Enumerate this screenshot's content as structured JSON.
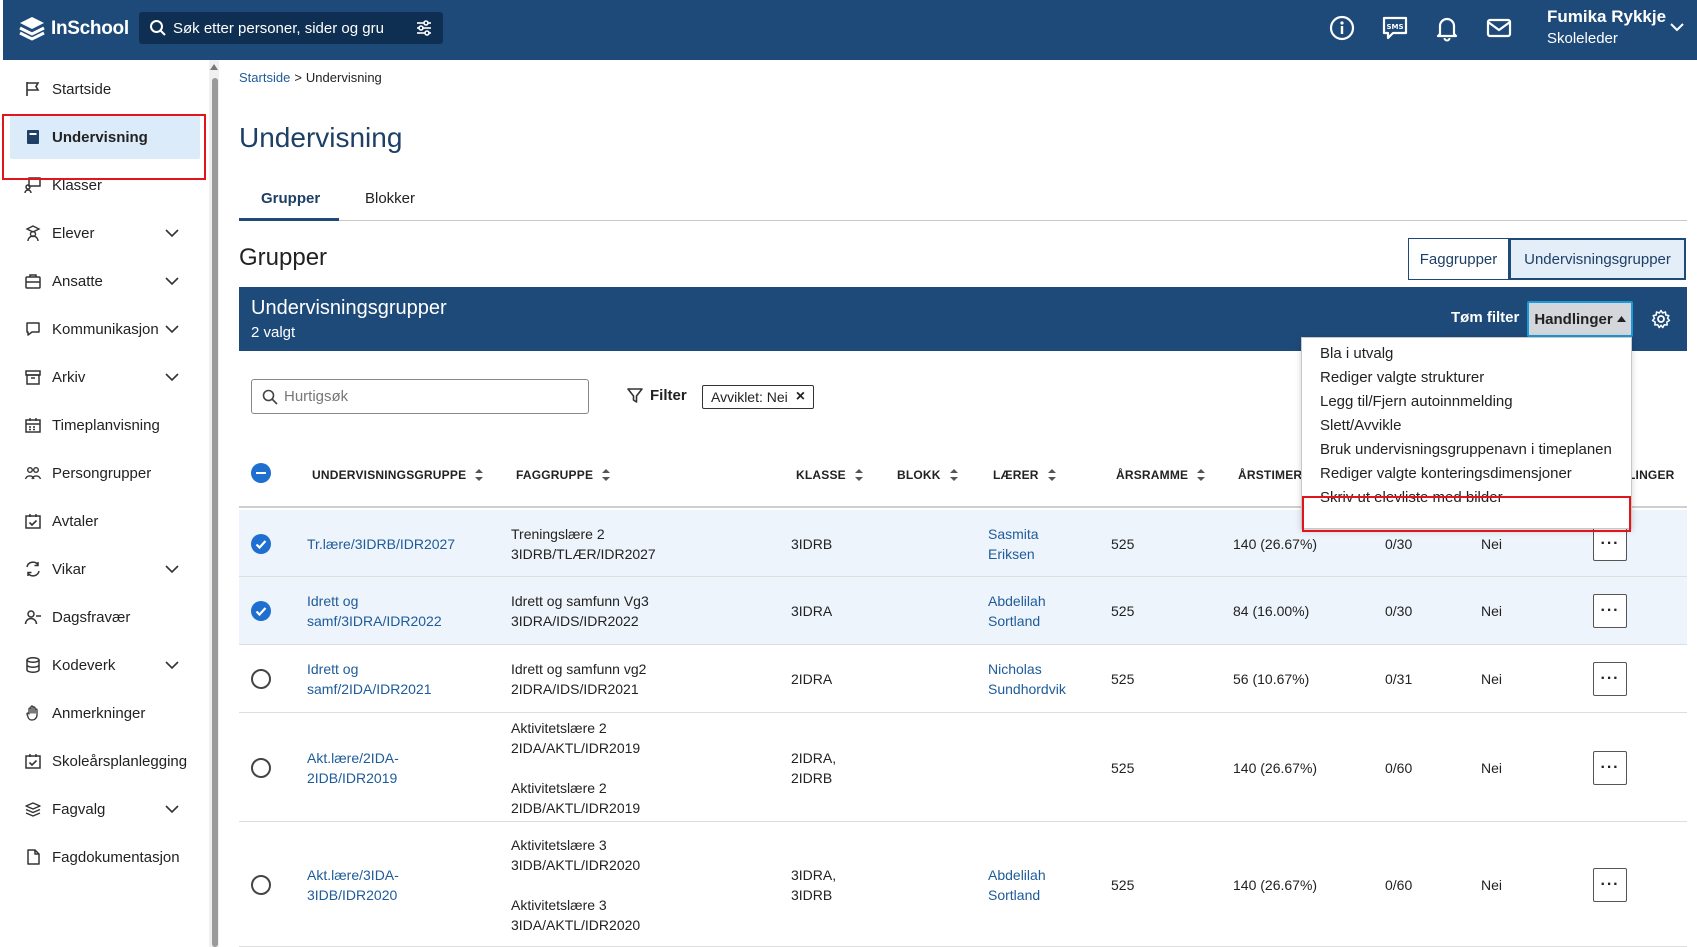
{
  "header": {
    "logo_text": "InSchool",
    "search_placeholder": "Søk etter personer, sider og gru",
    "user_name": "Fumika Rykkje",
    "user_role": "Skoleleder",
    "brand_color": "#1e4a7a"
  },
  "sidebar": {
    "items": [
      {
        "label": "Startside",
        "icon": "flag-icon"
      },
      {
        "label": "Undervisning",
        "icon": "book-icon"
      },
      {
        "label": "Klasser",
        "icon": "classroom-icon"
      },
      {
        "label": "Elever",
        "icon": "student-icon"
      },
      {
        "label": "Ansatte",
        "icon": "briefcase-icon"
      },
      {
        "label": "Kommunikasjon",
        "icon": "chat-icon"
      },
      {
        "label": "Arkiv",
        "icon": "archive-icon"
      },
      {
        "label": "Timeplanvisning",
        "icon": "calendar-icon"
      },
      {
        "label": "Persongrupper",
        "icon": "people-icon"
      },
      {
        "label": "Avtaler",
        "icon": "calendar-check-icon"
      },
      {
        "label": "Vikar",
        "icon": "swap-icon"
      },
      {
        "label": "Dagsfravær",
        "icon": "person-remove-icon"
      },
      {
        "label": "Kodeverk",
        "icon": "database-icon"
      },
      {
        "label": "Anmerkninger",
        "icon": "hand-icon"
      },
      {
        "label": "Skoleårsplanlegging",
        "icon": "calendar-check-icon"
      },
      {
        "label": "Fagvalg",
        "icon": "layers-icon"
      },
      {
        "label": "Fagdokumentasjon",
        "icon": "document-icon"
      }
    ]
  },
  "breadcrumb": {
    "home": "Startside",
    "separator": ">",
    "current": "Undervisning"
  },
  "page": {
    "title": "Undervisning",
    "section_title": "Grupper"
  },
  "tabs": [
    {
      "label": "Grupper"
    },
    {
      "label": "Blokker"
    }
  ],
  "segmented": {
    "off": "Faggrupper",
    "on": "Undervisningsgrupper"
  },
  "panel": {
    "title": "Undervisningsgrupper",
    "subtitle": "2 valgt",
    "clear_filter": "Tøm filter",
    "actions": "Handlinger"
  },
  "toolbar": {
    "quicksearch_placeholder": "Hurtigsøk",
    "filter_label": "Filter",
    "chip_label": "Avviklet: Nei",
    "chip_close": "×"
  },
  "table": {
    "columns": [
      "UNDERVISNINGSGRUPPE",
      "FAGGRUPPE",
      "KLASSE",
      "BLOKK",
      "LÆRER",
      "ÅRSRAMME",
      "ÅRSTIMER",
      "LINGER"
    ],
    "rows": [
      {
        "selected": true,
        "group": [
          "Tr.lære/3IDRB/IDR2027"
        ],
        "subject": [
          "Treningslære 2",
          "3IDRB/TLÆR/IDR2027"
        ],
        "klasse": [
          "3IDRB"
        ],
        "teacher": [
          "Sasmita",
          "Eriksen"
        ],
        "arsramme": "525",
        "arstimer": "140 (26.67%)",
        "count": "0/30",
        "avviklet": "Nei"
      },
      {
        "selected": true,
        "group": [
          "Idrett og",
          "samf/3IDRA/IDR2022"
        ],
        "subject": [
          "Idrett og samfunn Vg3",
          "3IDRA/IDS/IDR2022"
        ],
        "klasse": [
          "3IDRA"
        ],
        "teacher": [
          "Abdelilah",
          "Sortland"
        ],
        "arsramme": "525",
        "arstimer": "84 (16.00%)",
        "count": "0/30",
        "avviklet": "Nei"
      },
      {
        "selected": false,
        "group": [
          "Idrett og",
          "samf/2IDA/IDR2021"
        ],
        "subject": [
          "Idrett og samfunn vg2",
          "2IDRA/IDS/IDR2021"
        ],
        "klasse": [
          "2IDRA"
        ],
        "teacher": [
          "Nicholas",
          "Sundhordvik"
        ],
        "arsramme": "525",
        "arstimer": "56 (10.67%)",
        "count": "0/31",
        "avviklet": "Nei"
      },
      {
        "selected": false,
        "group": [
          "Akt.lære/2IDA-",
          "2IDB/IDR2019"
        ],
        "subject": [
          "Aktivitetslære 2",
          "2IDA/AKTL/IDR2019",
          "",
          "Aktivitetslære 2",
          "2IDB/AKTL/IDR2019"
        ],
        "klasse": [
          "2IDRA,",
          "2IDRB"
        ],
        "teacher": [],
        "arsramme": "525",
        "arstimer": "140 (26.67%)",
        "count": "0/60",
        "avviklet": "Nei"
      },
      {
        "selected": false,
        "group": [
          "Akt.lære/3IDA-",
          "3IDB/IDR2020"
        ],
        "subject": [
          "Aktivitetslære 3",
          "3IDB/AKTL/IDR2020",
          "",
          "Aktivitetslære 3",
          "3IDA/AKTL/IDR2020"
        ],
        "klasse": [
          "3IDRA,",
          "3IDRB"
        ],
        "teacher": [
          "Abdelilah",
          "Sortland"
        ],
        "arsramme": "525",
        "arstimer": "140 (26.67%)",
        "count": "0/60",
        "avviklet": "Nei"
      }
    ],
    "more_label": "···"
  },
  "dropdown": {
    "items": [
      "Bla i utvalg",
      "Rediger valgte strukturer",
      "Legg til/Fjern autoinnmelding",
      "Slett/Avvikle",
      "Bruk undervisningsgruppenavn i timeplanen",
      "Rediger valgte konteringsdimensjoner",
      "Skriv ut elevliste med bilder"
    ]
  }
}
